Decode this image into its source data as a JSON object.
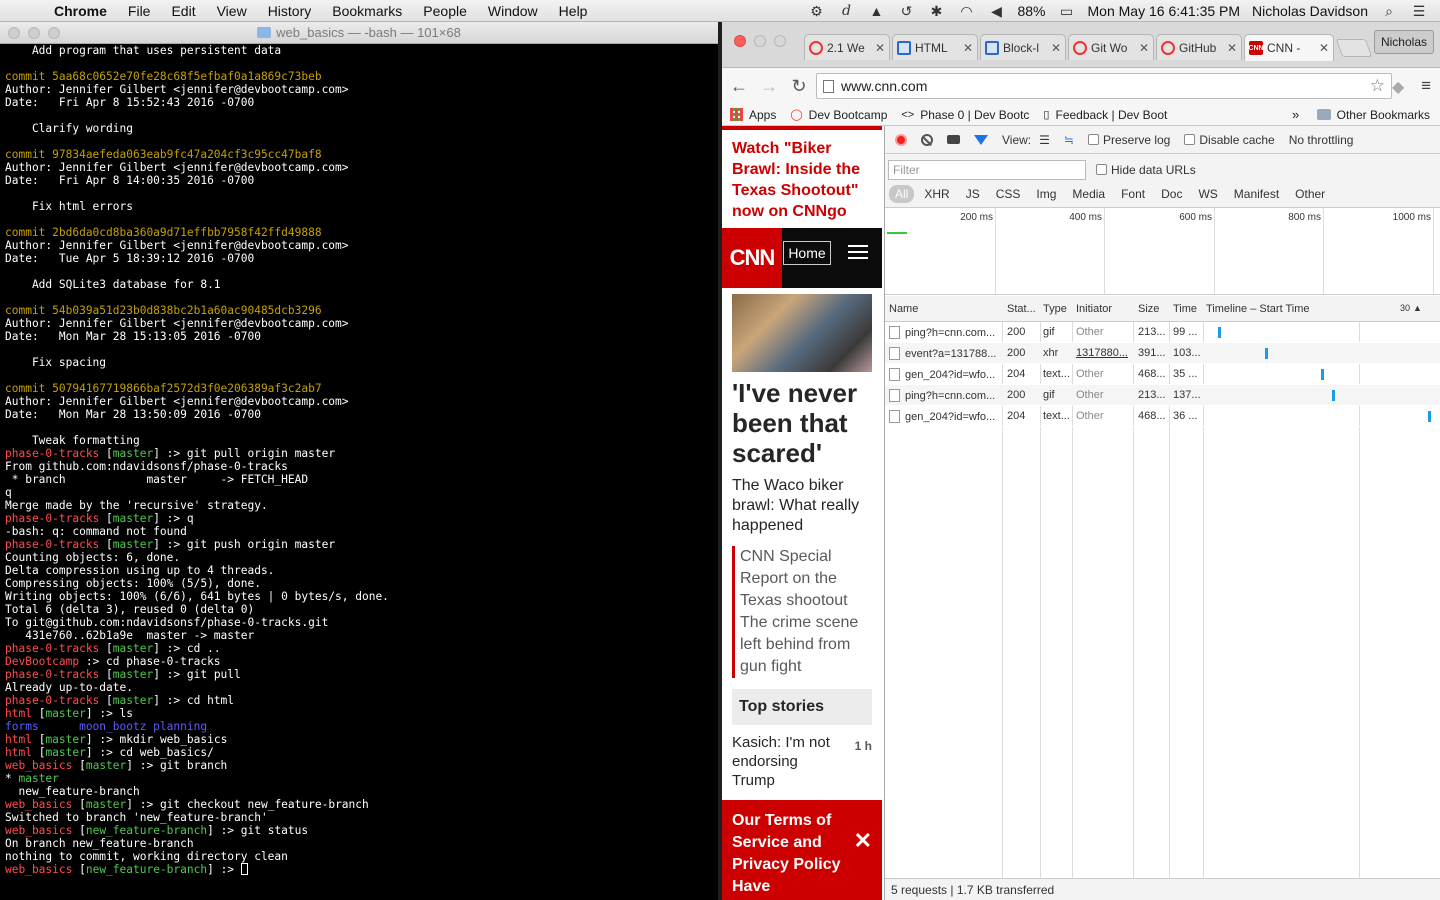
{
  "menubar": {
    "app": "Chrome",
    "items": [
      "File",
      "Edit",
      "View",
      "History",
      "Bookmarks",
      "People",
      "Window",
      "Help"
    ],
    "battery": "88%",
    "datetime": "Mon May 16  6:41:35 PM",
    "user": "Nicholas Davidson"
  },
  "terminal": {
    "title": "web_basics — -bash — 101×68",
    "lines": [
      [
        [
          "w",
          "    Add program that uses persistent data"
        ]
      ],
      [
        [
          "w",
          ""
        ]
      ],
      [
        [
          "y",
          "commit 5aa68c0652e70fe28c68f5efbaf0a1a869c73beb"
        ]
      ],
      [
        [
          "w",
          "Author: Jennifer Gilbert <jennifer@devbootcamp.com>"
        ]
      ],
      [
        [
          "w",
          "Date:   Fri Apr 8 15:52:43 2016 -0700"
        ]
      ],
      [
        [
          "w",
          ""
        ]
      ],
      [
        [
          "w",
          "    Clarify wording"
        ]
      ],
      [
        [
          "w",
          ""
        ]
      ],
      [
        [
          "y",
          "commit 97834aefeda063eab9fc47a204cf3c95cc47baf8"
        ]
      ],
      [
        [
          "w",
          "Author: Jennifer Gilbert <jennifer@devbootcamp.com>"
        ]
      ],
      [
        [
          "w",
          "Date:   Fri Apr 8 14:00:35 2016 -0700"
        ]
      ],
      [
        [
          "w",
          ""
        ]
      ],
      [
        [
          "w",
          "    Fix html errors"
        ]
      ],
      [
        [
          "w",
          ""
        ]
      ],
      [
        [
          "y",
          "commit 2bd6da0cd8ba360a9d71effbb7958f42ffd49888"
        ]
      ],
      [
        [
          "w",
          "Author: Jennifer Gilbert <jennifer@devbootcamp.com>"
        ]
      ],
      [
        [
          "w",
          "Date:   Tue Apr 5 18:39:12 2016 -0700"
        ]
      ],
      [
        [
          "w",
          ""
        ]
      ],
      [
        [
          "w",
          "    Add SQLite3 database for 8.1"
        ]
      ],
      [
        [
          "w",
          ""
        ]
      ],
      [
        [
          "y",
          "commit 54b039a51d23b0d838bc2b1a60ac90485dcb3296"
        ]
      ],
      [
        [
          "w",
          "Author: Jennifer Gilbert <jennifer@devbootcamp.com>"
        ]
      ],
      [
        [
          "w",
          "Date:   Mon Mar 28 15:13:05 2016 -0700"
        ]
      ],
      [
        [
          "w",
          ""
        ]
      ],
      [
        [
          "w",
          "    Fix spacing"
        ]
      ],
      [
        [
          "w",
          ""
        ]
      ],
      [
        [
          "y",
          "commit 50794167719866baf2572d3f0e206389af3c2ab7"
        ]
      ],
      [
        [
          "w",
          "Author: Jennifer Gilbert <jennifer@devbootcamp.com>"
        ]
      ],
      [
        [
          "w",
          "Date:   Mon Mar 28 13:50:09 2016 -0700"
        ]
      ],
      [
        [
          "w",
          ""
        ]
      ],
      [
        [
          "w",
          "    Tweak formatting"
        ]
      ],
      [
        [
          "r",
          "phase-0-tracks"
        ],
        [
          "w",
          " ["
        ],
        [
          "g",
          "master"
        ],
        [
          "w",
          "] :> git pull origin master"
        ]
      ],
      [
        [
          "w",
          "From github.com:ndavidsonsf/phase-0-tracks"
        ]
      ],
      [
        [
          "w",
          " * branch            master     -> FETCH_HEAD"
        ]
      ],
      [
        [
          "w",
          "q"
        ]
      ],
      [
        [
          "w",
          "Merge made by the 'recursive' strategy."
        ]
      ],
      [
        [
          "r",
          "phase-0-tracks"
        ],
        [
          "w",
          " ["
        ],
        [
          "g",
          "master"
        ],
        [
          "w",
          "] :> q"
        ]
      ],
      [
        [
          "w",
          "-bash: q: command not found"
        ]
      ],
      [
        [
          "r",
          "phase-0-tracks"
        ],
        [
          "w",
          " ["
        ],
        [
          "g",
          "master"
        ],
        [
          "w",
          "] :> git push origin master"
        ]
      ],
      [
        [
          "w",
          "Counting objects: 6, done."
        ]
      ],
      [
        [
          "w",
          "Delta compression using up to 4 threads."
        ]
      ],
      [
        [
          "w",
          "Compressing objects: 100% (5/5), done."
        ]
      ],
      [
        [
          "w",
          "Writing objects: 100% (6/6), 641 bytes | 0 bytes/s, done."
        ]
      ],
      [
        [
          "w",
          "Total 6 (delta 3), reused 0 (delta 0)"
        ]
      ],
      [
        [
          "w",
          "To git@github.com:ndavidsonsf/phase-0-tracks.git"
        ]
      ],
      [
        [
          "w",
          "   431e760..62b1a9e  master -> master"
        ]
      ],
      [
        [
          "r",
          "phase-0-tracks"
        ],
        [
          "w",
          " ["
        ],
        [
          "g",
          "master"
        ],
        [
          "w",
          "] :> cd .."
        ]
      ],
      [
        [
          "r",
          "DevBootcamp"
        ],
        [
          "w",
          " :> cd phase-0-tracks"
        ]
      ],
      [
        [
          "r",
          "phase-0-tracks"
        ],
        [
          "w",
          " ["
        ],
        [
          "g",
          "master"
        ],
        [
          "w",
          "] :> git pull"
        ]
      ],
      [
        [
          "w",
          "Already up-to-date."
        ]
      ],
      [
        [
          "r",
          "phase-0-tracks"
        ],
        [
          "w",
          " ["
        ],
        [
          "g",
          "master"
        ],
        [
          "w",
          "] :> cd html"
        ]
      ],
      [
        [
          "r",
          "html"
        ],
        [
          "w",
          " ["
        ],
        [
          "g",
          "master"
        ],
        [
          "w",
          "] :> ls"
        ]
      ],
      [
        [
          "b",
          "forms      moon_bootz planning"
        ]
      ],
      [
        [
          "r",
          "html"
        ],
        [
          "w",
          " ["
        ],
        [
          "g",
          "master"
        ],
        [
          "w",
          "] :> mkdir web_basics"
        ]
      ],
      [
        [
          "r",
          "html"
        ],
        [
          "w",
          " ["
        ],
        [
          "g",
          "master"
        ],
        [
          "w",
          "] :> cd web_basics/"
        ]
      ],
      [
        [
          "r",
          "web_basics"
        ],
        [
          "w",
          " ["
        ],
        [
          "g",
          "master"
        ],
        [
          "w",
          "] :> git branch"
        ]
      ],
      [
        [
          "w",
          "* "
        ],
        [
          "g",
          "master"
        ]
      ],
      [
        [
          "w",
          "  new_feature-branch"
        ]
      ],
      [
        [
          "r",
          "web_basics"
        ],
        [
          "w",
          " ["
        ],
        [
          "g",
          "master"
        ],
        [
          "w",
          "] :> git checkout new_feature-branch"
        ]
      ],
      [
        [
          "w",
          "Switched to branch 'new_feature-branch'"
        ]
      ],
      [
        [
          "r",
          "web_basics"
        ],
        [
          "w",
          " ["
        ],
        [
          "g",
          "new_feature-branch"
        ],
        [
          "w",
          "] :> git status"
        ]
      ],
      [
        [
          "w",
          "On branch new_feature-branch"
        ]
      ],
      [
        [
          "w",
          "nothing to commit, working directory clean"
        ]
      ],
      [
        [
          "r",
          "web_basics"
        ],
        [
          "w",
          " ["
        ],
        [
          "g",
          "new_feature-branch"
        ],
        [
          "w",
          "] :> "
        ]
      ]
    ]
  },
  "chrome": {
    "tabs": [
      {
        "label": "2.1 We",
        "icon": "red-circle"
      },
      {
        "label": "HTML",
        "icon": "blue-box"
      },
      {
        "label": "Block-l",
        "icon": "blue-box"
      },
      {
        "label": "Git Wo",
        "icon": "red-circle"
      },
      {
        "label": "GitHub",
        "icon": "red-circle"
      },
      {
        "label": "CNN -",
        "icon": "cnn"
      }
    ],
    "profile": "Nicholas",
    "url": "www.cnn.com",
    "bookmarks": [
      "Apps",
      "Dev Bootcamp",
      "Phase 0 | Dev Bootc",
      "Feedback | Dev Boot"
    ],
    "bookmarks_more": "»",
    "other_bookmarks": "Other Bookmarks"
  },
  "cnn": {
    "watch": "Watch \"Biker Brawl: Inside the Texas Shootout\" now on CNNgo",
    "logo": "CNN",
    "home": "Home",
    "headline": "'I've never been that scared'",
    "subhead": "The Waco biker brawl: What really happened",
    "related": [
      "CNN Special Report on the Texas shootout",
      "The crime scene left behind from gun fight"
    ],
    "top_stories": "Top stories",
    "story": "Kasich: I'm not endorsing Trump",
    "story_age": "1 h",
    "terms": "Our Terms of Service and Privacy Policy Have"
  },
  "devtools": {
    "view_label": "View:",
    "preserve_log": "Preserve log",
    "disable_cache": "Disable cache",
    "throttling": "No throttling",
    "filter_placeholder": "Filter",
    "hide_data_urls": "Hide data URLs",
    "types": [
      "All",
      "XHR",
      "JS",
      "CSS",
      "Img",
      "Media",
      "Font",
      "Doc",
      "WS",
      "Manifest",
      "Other"
    ],
    "ticks": [
      "200 ms",
      "400 ms",
      "600 ms",
      "800 ms",
      "1000 ms"
    ],
    "columns": [
      "Name",
      "Stat...",
      "Type",
      "Initiator",
      "Size",
      "Time",
      "Timeline – Start Time",
      "30"
    ],
    "rows": [
      {
        "name": "ping?h=cnn.com...",
        "status": "200",
        "type": "gif",
        "initiator": "Other",
        "size": "213...",
        "time": "99 ..."
      },
      {
        "name": "event?a=131788...",
        "status": "200",
        "type": "xhr",
        "initiator": "1317880...",
        "size": "391...",
        "time": "103..."
      },
      {
        "name": "gen_204?id=wfo...",
        "status": "204",
        "type": "text...",
        "initiator": "Other",
        "size": "468...",
        "time": "35 ..."
      },
      {
        "name": "ping?h=cnn.com...",
        "status": "200",
        "type": "gif",
        "initiator": "Other",
        "size": "213...",
        "time": "137..."
      },
      {
        "name": "gen_204?id=wfo...",
        "status": "204",
        "type": "text...",
        "initiator": "Other",
        "size": "468...",
        "time": "36 ..."
      }
    ],
    "status": "5 requests  |  1.7 KB transferred"
  }
}
